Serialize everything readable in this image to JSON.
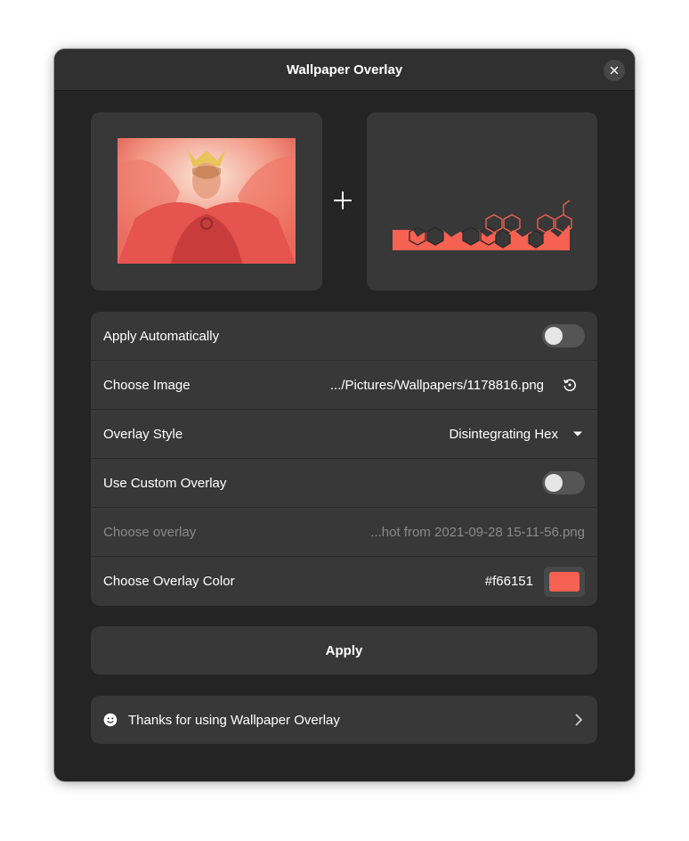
{
  "window": {
    "title": "Wallpaper Overlay"
  },
  "colors": {
    "overlay": "#f66151",
    "window_bg": "#242424",
    "card_bg": "#383838"
  },
  "preview": {
    "wallpaper_icon": "wallpaper-image",
    "combine_icon": "plus-icon",
    "overlay_icon": "hex-overlay-image"
  },
  "settings": {
    "apply_auto": {
      "label": "Apply Automatically",
      "enabled": false
    },
    "choose_image": {
      "label": "Choose Image",
      "value": ".../Pictures/Wallpapers/1178816.png",
      "icon": "reset-icon"
    },
    "overlay_style": {
      "label": "Overlay Style",
      "value": "Disintegrating Hex",
      "icon": "dropdown-arrow-icon"
    },
    "custom_overlay": {
      "label": "Use Custom Overlay",
      "enabled": false
    },
    "choose_overlay": {
      "label": "Choose overlay",
      "value": "...hot from 2021-09-28 15-11-56.png"
    },
    "overlay_color": {
      "label": "Choose Overlay Color",
      "value": "#f66151"
    }
  },
  "apply": {
    "label": "Apply"
  },
  "footer": {
    "label": "Thanks for using Wallpaper Overlay",
    "icon": "smile-icon",
    "chevron": "chevron-right-icon"
  }
}
